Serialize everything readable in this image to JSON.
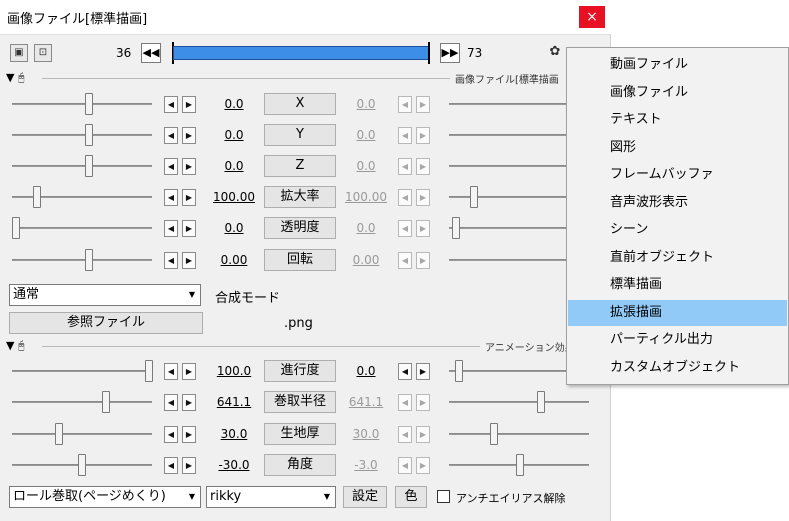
{
  "window": {
    "title": "画像ファイル[標準描画]",
    "close_glyph": "×"
  },
  "toolbar": {
    "start_frame": "36",
    "end_frame": "73",
    "prev_glyph": "◀◀",
    "next_glyph": "▶▶"
  },
  "section1": {
    "title": "画像ファイル[標準描画"
  },
  "params": [
    {
      "left": "0.0",
      "label": "X",
      "right": "0.0"
    },
    {
      "left": "0.0",
      "label": "Y",
      "right": "0.0"
    },
    {
      "left": "0.0",
      "label": "Z",
      "right": "0.0"
    },
    {
      "left": "100.00",
      "label": "拡大率",
      "right": "100.00"
    },
    {
      "left": "0.0",
      "label": "透明度",
      "right": "0.0"
    },
    {
      "left": "0.00",
      "label": "回転",
      "right": "0.00"
    }
  ],
  "blend": {
    "value": "通常",
    "label": "合成モード"
  },
  "file": {
    "button": "参照ファイル",
    "name": ".png"
  },
  "section2": {
    "title": "アニメーション効果"
  },
  "anim_params": [
    {
      "left": "100.0",
      "label": "進行度",
      "right": "0.0"
    },
    {
      "left": "641.1",
      "label": "巻取半径",
      "right": "641.1"
    },
    {
      "left": "30.0",
      "label": "生地厚",
      "right": "30.0"
    },
    {
      "left": "-30.0",
      "label": "角度",
      "right": "-3.0"
    }
  ],
  "bottom": {
    "effect_select": "ロール巻取(ページめくり)",
    "name_select": "rikky",
    "settings_button": "設定",
    "color_button": "色",
    "antialias_label": "アンチエイリアス解除"
  },
  "menu": {
    "items": [
      "動画ファイル",
      "画像ファイル",
      "テキスト",
      "図形",
      "フレームバッファ",
      "音声波形表示",
      "シーン",
      "直前オブジェクト",
      "標準描画",
      "拡張描画",
      "パーティクル出力",
      "カスタムオブジェクト"
    ],
    "highlighted_index": 9
  },
  "glyphs": {
    "arrow_left": "◀",
    "arrow_right": "▶",
    "dropdown": "▼",
    "collapse": "▼",
    "mouse": "🖰"
  },
  "colors": {
    "timeline": "#3c8ee6",
    "menu_highlight": "#91c9f7",
    "close": "#e81123"
  }
}
